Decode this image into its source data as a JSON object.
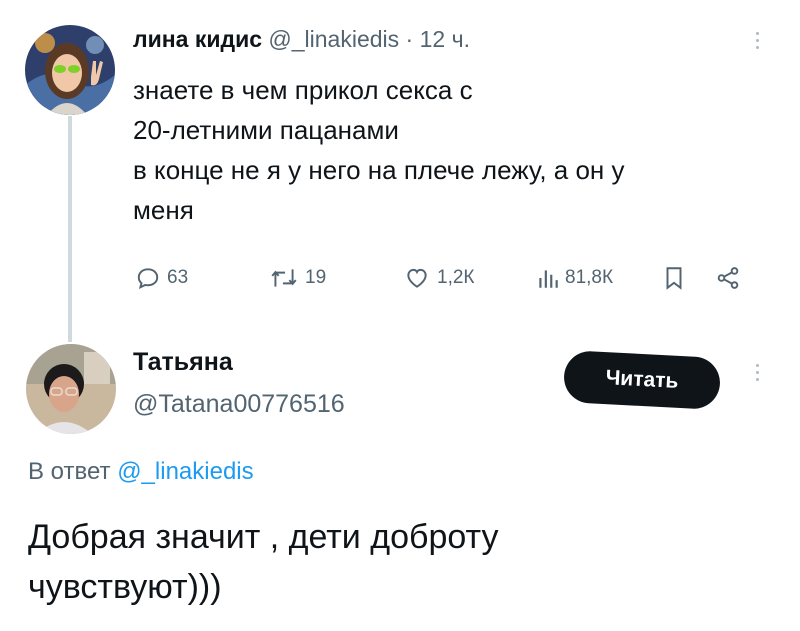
{
  "tweet": {
    "author_name": "лина кидис",
    "handle": "@_linakiedis",
    "separator": "·",
    "time": "12 ч.",
    "lines": [
      "знаете в чем прикол секса с",
      "20-летними пацанами",
      "в конце не я у него на плече лежу, а он у",
      "меня"
    ],
    "stats": {
      "replies": "63",
      "retweets": "19",
      "likes": "1,2К",
      "views": "81,8К"
    },
    "icons": [
      "reply-icon",
      "retweet-icon",
      "like-icon",
      "views-icon",
      "bookmark-icon",
      "share-icon",
      "more-icon"
    ]
  },
  "reply": {
    "author_name": "Татьяна",
    "handle": "@Tatana00776516",
    "follow_label": "Читать",
    "reply_prefix": "В ответ",
    "reply_handle": "@_linakiedis",
    "lines": [
      "Добрая значит , дети доброту",
      "чувствуют)))"
    ],
    "icons": [
      "more-icon"
    ]
  },
  "colors": {
    "text": "#0f1419",
    "secondary": "#536471",
    "link": "#1d9bf0",
    "thread_line": "#cfd9de",
    "button": "#0f1419"
  }
}
